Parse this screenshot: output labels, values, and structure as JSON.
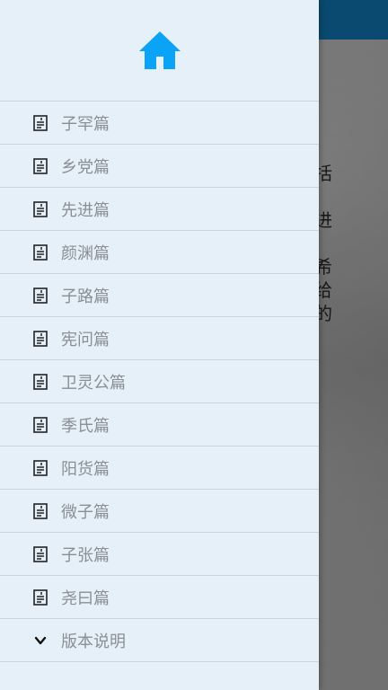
{
  "background": {
    "text_lines": "也括\n选\n而进\n支\n。希\n读给\n故的"
  },
  "drawer": {
    "home_icon": "home-icon",
    "accent": "#0aa3f5",
    "items": [
      {
        "label": "子罕篇",
        "icon": "document-icon"
      },
      {
        "label": "乡党篇",
        "icon": "document-icon"
      },
      {
        "label": "先进篇",
        "icon": "document-icon"
      },
      {
        "label": "颜渊篇",
        "icon": "document-icon"
      },
      {
        "label": "子路篇",
        "icon": "document-icon"
      },
      {
        "label": "宪问篇",
        "icon": "document-icon"
      },
      {
        "label": "卫灵公篇",
        "icon": "document-icon"
      },
      {
        "label": "季氏篇",
        "icon": "document-icon"
      },
      {
        "label": "阳货篇",
        "icon": "document-icon"
      },
      {
        "label": "微子篇",
        "icon": "document-icon"
      },
      {
        "label": "子张篇",
        "icon": "document-icon"
      },
      {
        "label": "尧曰篇",
        "icon": "document-icon"
      }
    ],
    "version": {
      "label": "版本说明",
      "icon": "chevron-down-icon"
    }
  }
}
